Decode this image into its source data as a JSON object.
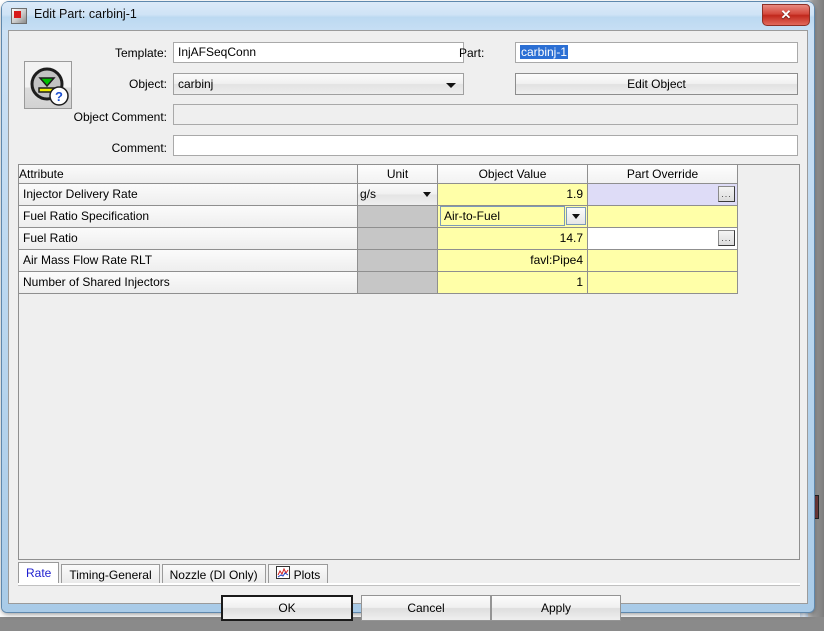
{
  "window": {
    "title": "Edit Part: carbinj-1",
    "icon": "application-icon",
    "close_label": "✕"
  },
  "form": {
    "object_icon": "injector-object-icon",
    "template_label": "Template:",
    "template_value": "InjAFSeqConn",
    "object_label": "Object:",
    "object_value": "carbinj",
    "object_comment_label": "Object Comment:",
    "object_comment_value": "",
    "comment_label": "Comment:",
    "comment_value": "",
    "part_label": "Part:",
    "part_value": "carbinj-1",
    "edit_object_label": "Edit Object"
  },
  "table": {
    "columns": [
      "Attribute",
      "Unit",
      "Object Value",
      "Part Override"
    ],
    "rows": [
      {
        "attribute": "Injector Delivery Rate",
        "unit": "g/s",
        "unit_type": "combo",
        "value": "1.9",
        "value_type": "text",
        "override": "",
        "override_style": "focus",
        "override_button": "..."
      },
      {
        "attribute": "Fuel Ratio Specification",
        "unit": "",
        "unit_type": "disabled",
        "value": "Air-to-Fuel",
        "value_type": "combo",
        "override": "",
        "override_style": "yellow",
        "override_button": ""
      },
      {
        "attribute": "Fuel Ratio",
        "unit": "",
        "unit_type": "disabled",
        "value": "14.7",
        "value_type": "text",
        "override": "",
        "override_style": "white",
        "override_button": "..."
      },
      {
        "attribute": "Air Mass Flow Rate RLT",
        "unit": "",
        "unit_type": "disabled",
        "value": "favl:Pipe4",
        "value_type": "text",
        "override": "",
        "override_style": "yellow",
        "override_button": ""
      },
      {
        "attribute": "Number of Shared Injectors",
        "unit": "",
        "unit_type": "disabled",
        "value": "1",
        "value_type": "text",
        "override": "",
        "override_style": "yellow",
        "override_button": ""
      }
    ]
  },
  "tabs": [
    {
      "label": "Rate",
      "active": true,
      "icon": ""
    },
    {
      "label": "Timing-General",
      "active": false,
      "icon": ""
    },
    {
      "label": "Nozzle (DI Only)",
      "active": false,
      "icon": ""
    },
    {
      "label": "Plots",
      "active": false,
      "icon": "chart-icon"
    }
  ],
  "buttons": {
    "ok": "OK",
    "cancel": "Cancel",
    "apply": "Apply"
  },
  "colors": {
    "value_cell": "#ffffa8",
    "override_focus": "#dedcf7",
    "unit_disabled": "#c6c6c6",
    "active_tab_text": "#2020d0",
    "selection": "#2b6fd4"
  }
}
